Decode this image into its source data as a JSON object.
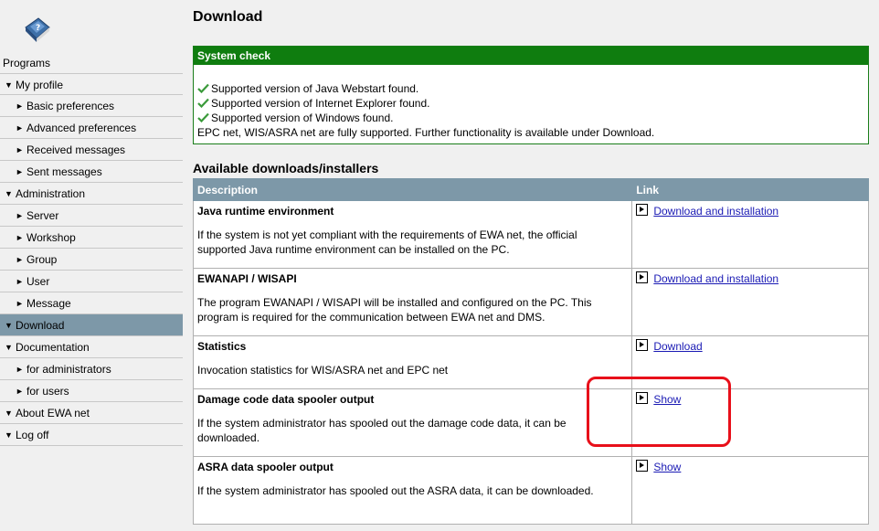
{
  "sidebar": {
    "programs_label": "Programs",
    "items": [
      {
        "label": "My profile",
        "level": 1,
        "marker": "▼"
      },
      {
        "label": "Basic preferences",
        "level": 2,
        "marker": "►"
      },
      {
        "label": "Advanced preferences",
        "level": 2,
        "marker": "►"
      },
      {
        "label": "Received messages",
        "level": 2,
        "marker": "►"
      },
      {
        "label": "Sent messages",
        "level": 2,
        "marker": "►"
      },
      {
        "label": "Administration",
        "level": 1,
        "marker": "▼"
      },
      {
        "label": "Server",
        "level": 2,
        "marker": "►"
      },
      {
        "label": "Workshop",
        "level": 2,
        "marker": "►"
      },
      {
        "label": "Group",
        "level": 2,
        "marker": "►"
      },
      {
        "label": "User",
        "level": 2,
        "marker": "►"
      },
      {
        "label": "Message",
        "level": 2,
        "marker": "►"
      },
      {
        "label": "Download",
        "level": 1,
        "marker": "▼",
        "active": true
      },
      {
        "label": "Documentation",
        "level": 1,
        "marker": "▼"
      },
      {
        "label": "for administrators",
        "level": 2,
        "marker": "►"
      },
      {
        "label": "for users",
        "level": 2,
        "marker": "►"
      },
      {
        "label": "About EWA net",
        "level": 1,
        "marker": "▼"
      },
      {
        "label": "Log off",
        "level": 1,
        "marker": "▼"
      }
    ]
  },
  "main": {
    "title": "Download",
    "system_check": {
      "title": "System check",
      "checks": [
        "Supported version of Java Webstart found.",
        "Supported version of Internet Explorer found.",
        "Supported version of Windows found."
      ],
      "summary": "EPC net, WIS/ASRA net are fully supported. Further functionality is available under Download."
    },
    "downloads": {
      "title": "Available downloads/installers",
      "headers": {
        "description": "Description",
        "link": "Link"
      },
      "rows": [
        {
          "title": "Java runtime environment",
          "description": "If the system is not yet compliant with the requirements of EWA net, the official supported Java runtime environment can be installed on the PC.",
          "link": "Download and installation"
        },
        {
          "title": "EWANAPI / WISAPI",
          "description": "The program EWANAPI / WISAPI will be installed and configured on the PC. This program is required for the communication between EWA net and DMS.",
          "link": "Download and installation"
        },
        {
          "title": "Statistics",
          "description": "Invocation statistics for WIS/ASRA net and EPC net",
          "link": "Download"
        },
        {
          "title": "Damage code data spooler output",
          "description": "If the system administrator has spooled out the damage code data, it can be downloaded.",
          "link": "Show"
        },
        {
          "title": "ASRA data spooler output",
          "description": "If the system administrator has spooled out the ASRA data, it can be downloaded.",
          "link": "Show"
        }
      ]
    }
  },
  "colors": {
    "sidebar_active": "#7d98a8",
    "table_header": "#7d98a8",
    "system_check_header": "#0f7d0f",
    "link": "#1a1ab4",
    "highlight": "#e8101a"
  }
}
